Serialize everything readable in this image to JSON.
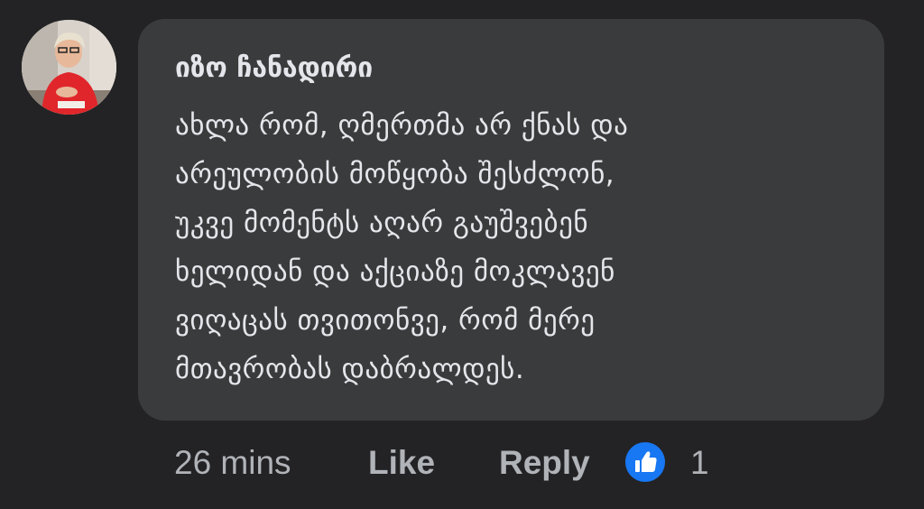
{
  "comment": {
    "author": "იზო ჩანადირი",
    "lines": [
      "ახლა რომ, ღმერთმა არ ქნას და",
      "არეულობის მოწყობა შესძლონ,",
      "უკვე მომენტს აღარ გაუშვებენ",
      "ხელიდან და აქციაზე მოკლავენ",
      "ვიღაცას თვითონვე, რომ  მერე",
      "მთავრობას დაბრალდეს."
    ],
    "timestamp": "26 mins",
    "like_label": "Like",
    "reply_label": "Reply",
    "reaction": {
      "icon": "thumbs-up-icon",
      "count": "1",
      "color": "#1877f2"
    }
  },
  "colors": {
    "background": "#232325",
    "bubble": "#3a3b3c",
    "text": "#e4e6eb",
    "secondary_text": "#b0b3b8"
  }
}
